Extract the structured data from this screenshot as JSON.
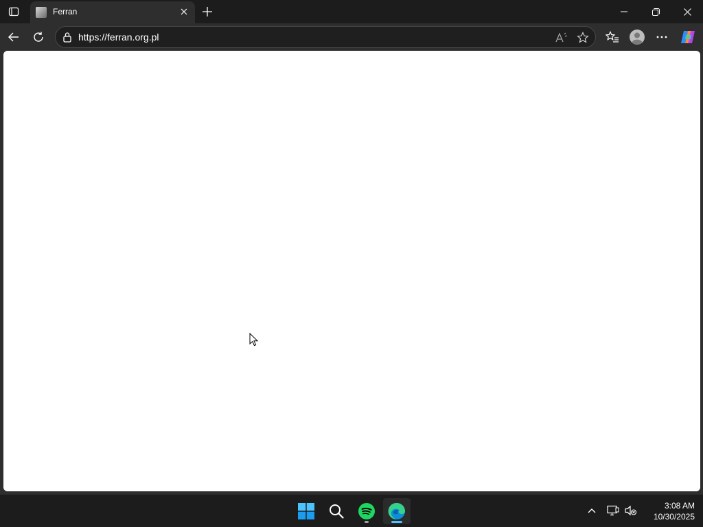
{
  "browser": {
    "tab": {
      "title": "Ferran",
      "active": true
    },
    "address": {
      "url": "https://ferran.org.pl",
      "icon": "lock-icon"
    },
    "toolbar_icons": [
      "back-icon",
      "refresh-icon",
      "read-aloud-icon",
      "favorite-star-icon",
      "favorites-icon",
      "profile-icon",
      "more-icon",
      "copilot-icon"
    ],
    "window_controls": [
      "minimize-icon",
      "restore-icon",
      "close-icon"
    ]
  },
  "page": {
    "state": "blank-white"
  },
  "taskbar": {
    "apps": [
      {
        "name": "Start",
        "icon": "windows-icon"
      },
      {
        "name": "Search",
        "icon": "search-icon"
      },
      {
        "name": "Spotify",
        "icon": "spotify-icon",
        "running": true
      },
      {
        "name": "Microsoft Edge",
        "icon": "edge-icon",
        "active": true
      }
    ],
    "tray_icons": [
      "chevron-up-icon",
      "network-icon",
      "volume-muted-icon"
    ],
    "time": "3:08 AM",
    "date": "10/30/2025"
  },
  "colors": {
    "chrome_dark": "#1c1c1c",
    "toolbar": "#2e2e2e",
    "text": "#ffffff",
    "accent_blue": "#4cc2ff",
    "spotify_green": "#1ed760"
  }
}
